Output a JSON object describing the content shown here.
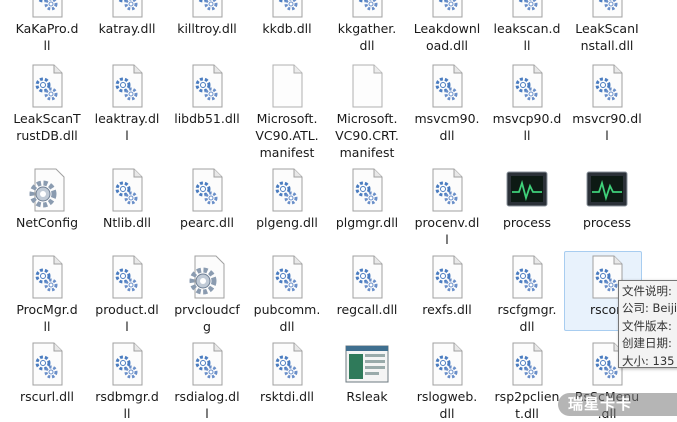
{
  "files": [
    {
      "label": "KaKaPro.d\nll",
      "type": "dll"
    },
    {
      "label": "katray.dll",
      "type": "dll"
    },
    {
      "label": "killtroy.dll",
      "type": "dll"
    },
    {
      "label": "kkdb.dll",
      "type": "dll"
    },
    {
      "label": "kkgather.\ndll",
      "type": "dll"
    },
    {
      "label": "Leakdownl\noad.dll",
      "type": "dll"
    },
    {
      "label": "leakscan.d\nll",
      "type": "dll"
    },
    {
      "label": "LeakScanI\nnstall.dll",
      "type": "dll"
    },
    {
      "label": "LeakScanT\nrustDB.dll",
      "type": "dll"
    },
    {
      "label": "leaktray.dl\nl",
      "type": "dll"
    },
    {
      "label": "libdb51.dll",
      "type": "dll"
    },
    {
      "label": "Microsoft.\nVC90.ATL.\nmanifest",
      "type": "doc"
    },
    {
      "label": "Microsoft.\nVC90.CRT.\nmanifest",
      "type": "doc"
    },
    {
      "label": "msvcm90.\ndll",
      "type": "dll"
    },
    {
      "label": "msvcp90.d\nll",
      "type": "dll"
    },
    {
      "label": "msvcr90.dl\nl",
      "type": "dll"
    },
    {
      "label": "NetConfig",
      "type": "config"
    },
    {
      "label": "Ntlib.dll",
      "type": "dll"
    },
    {
      "label": "pearc.dll",
      "type": "dll"
    },
    {
      "label": "plgeng.dll",
      "type": "dll"
    },
    {
      "label": "plgmgr.dll",
      "type": "dll"
    },
    {
      "label": "procenv.dl\nl",
      "type": "dll"
    },
    {
      "label": "process",
      "type": "monitor"
    },
    {
      "label": "process",
      "type": "monitor"
    },
    {
      "label": "ProcMgr.d\nll",
      "type": "dll"
    },
    {
      "label": "product.dl\nl",
      "type": "dll"
    },
    {
      "label": "prvcloudcf\ng",
      "type": "config"
    },
    {
      "label": "pubcomm.\ndll",
      "type": "dll"
    },
    {
      "label": "regcall.dll",
      "type": "dll"
    },
    {
      "label": "rexfs.dll",
      "type": "dll"
    },
    {
      "label": "rscfgmgr.\ndll",
      "type": "dll"
    },
    {
      "label": "rscon",
      "type": "dll",
      "selected": true
    },
    {
      "label": "rscurl.dll",
      "type": "dll"
    },
    {
      "label": "rsdbmgr.d\nll",
      "type": "dll"
    },
    {
      "label": "rsdialog.dl\nl",
      "type": "dll"
    },
    {
      "label": "rsktdi.dll",
      "type": "dll"
    },
    {
      "label": "Rsleak",
      "type": "app"
    },
    {
      "label": "rslogweb.\ndll",
      "type": "dll"
    },
    {
      "label": "rsp2pclien\nt.dll",
      "type": "dll"
    },
    {
      "label": "RsScMenu\n.dll",
      "type": "dll"
    }
  ],
  "tooltip": {
    "line1": "文件说明:",
    "line2": "公司: Beiji",
    "line3": "文件版本:",
    "line4": "创建日期:",
    "line5": "大小: 135"
  },
  "watermark": "瑞星卡卡",
  "colors": {
    "selection_bg": "#e8f2fc",
    "selection_border": "#a8cdf0",
    "gear_blue": "#3c6fb8"
  }
}
